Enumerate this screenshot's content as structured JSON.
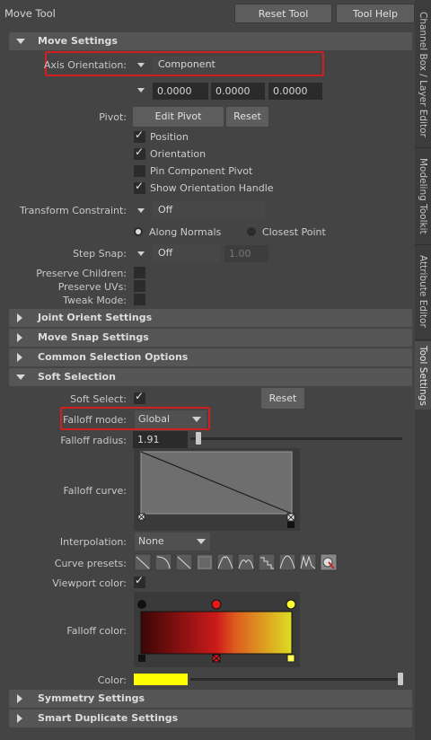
{
  "header": {
    "title": "Move Tool",
    "reset_tool": "Reset Tool",
    "tool_help": "Tool Help"
  },
  "move_settings": {
    "header": "Move Settings",
    "axis_label": "Axis Orientation:",
    "axis_value": "Component",
    "coords": [
      "0.0000",
      "0.0000",
      "0.0000"
    ],
    "pivot_label": "Pivot:",
    "edit_pivot": "Edit Pivot",
    "reset": "Reset",
    "position": "Position",
    "orientation": "Orientation",
    "pin_component_pivot": "Pin Component Pivot",
    "show_orientation_handle": "Show Orientation Handle",
    "transform_constraint_label": "Transform Constraint:",
    "transform_constraint_value": "Off",
    "along_normals": "Along Normals",
    "closest_point": "Closest Point",
    "step_snap_label": "Step Snap:",
    "step_snap_value": "Off",
    "step_snap_amount": "1.00",
    "preserve_children": "Preserve Children:",
    "preserve_uvs": "Preserve UVs:",
    "tweak_mode": "Tweak Mode:"
  },
  "collapsed_sections": {
    "joint_orient": "Joint Orient Settings",
    "move_snap": "Move Snap Settings",
    "common_selection": "Common Selection Options",
    "symmetry": "Symmetry Settings",
    "smart_duplicate": "Smart Duplicate Settings"
  },
  "soft_selection": {
    "header": "Soft Selection",
    "soft_select_label": "Soft Select:",
    "reset": "Reset",
    "falloff_mode_label": "Falloff mode:",
    "falloff_mode_value": "Global",
    "falloff_radius_label": "Falloff radius:",
    "falloff_radius_value": "1.91",
    "falloff_radius_fraction": 0.25,
    "falloff_curve_label": "Falloff curve:",
    "interpolation_label": "Interpolation:",
    "interpolation_value": "None",
    "curve_presets_label": "Curve presets:",
    "viewport_color_label": "Viewport color:",
    "falloff_color_label": "Falloff color:",
    "color_label": "Color:",
    "color_value": "#ffff00"
  },
  "side_tabs": [
    "Channel Box / Layer Editor",
    "Modeling Toolkit",
    "Attribute Editor",
    "Tool Settings"
  ],
  "colors": {
    "accent_red": "#d11e1e",
    "gradient_start": "#4a0a0a",
    "gradient_mid": "#cc1a1a",
    "gradient_end": "#dddd22"
  }
}
